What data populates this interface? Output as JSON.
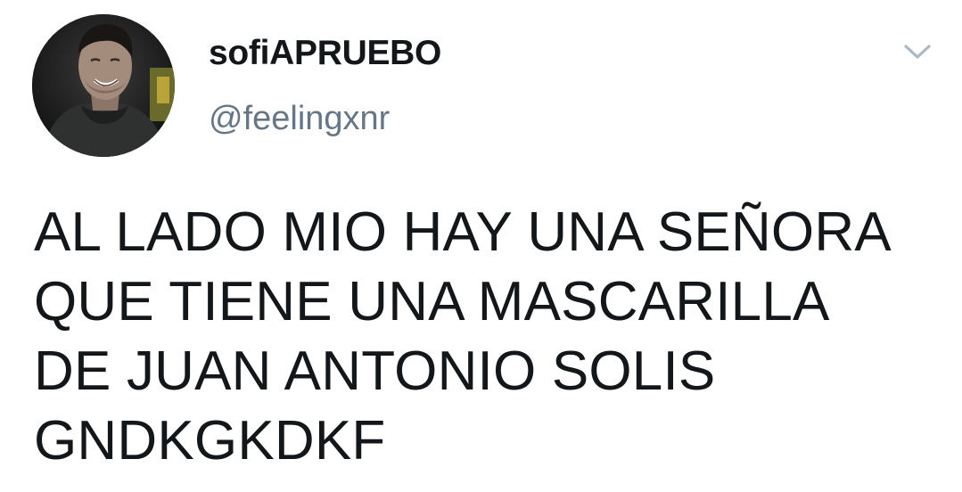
{
  "tweet": {
    "author": {
      "display_name": "sofiAPRUEBO",
      "handle": "@feelingxnr"
    },
    "menu_icon": "chevron-down-icon",
    "text_lines": [
      "AL LADO MIO HAY UNA SEÑORA",
      "QUE TIENE UNA MASCARILLA",
      "DE JUAN ANTONIO SOLIS",
      "GNDKGKDKF"
    ]
  },
  "colors": {
    "text": "#14171a",
    "secondary_text": "#657786",
    "chevron": "#aab8c2",
    "background": "#ffffff"
  }
}
